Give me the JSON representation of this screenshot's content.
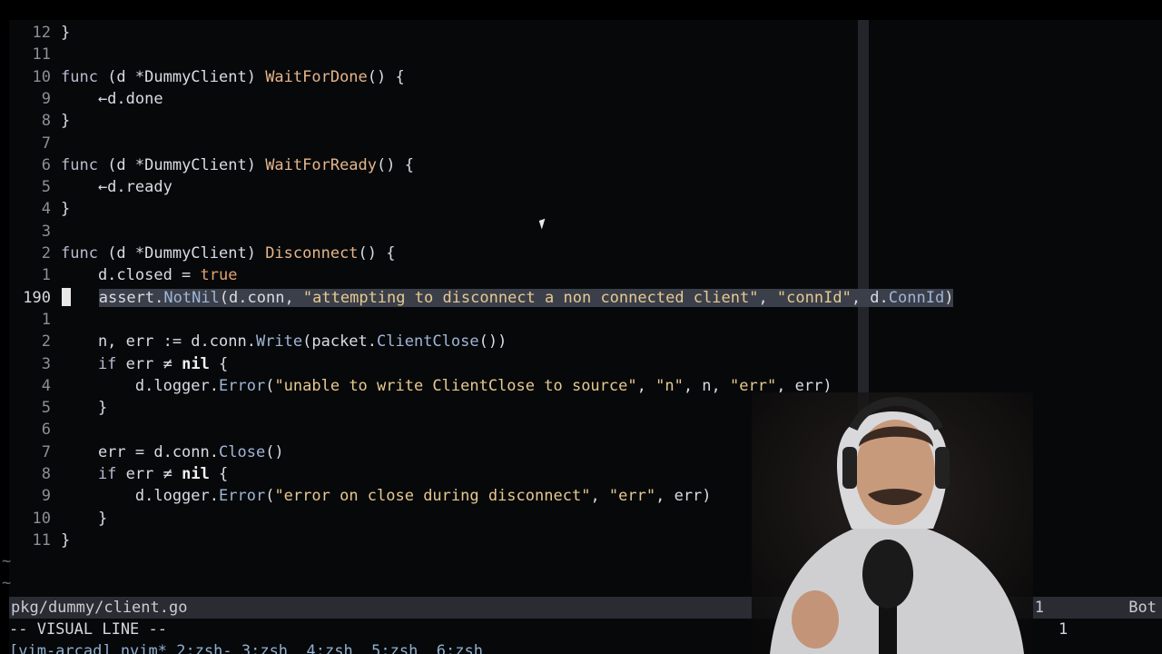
{
  "editor": {
    "lines": [
      {
        "num": "12",
        "parts": [
          [
            "typ",
            "}"
          ]
        ]
      },
      {
        "num": "11",
        "parts": []
      },
      {
        "num": "10",
        "parts": [
          [
            "kw",
            "func "
          ],
          [
            "typ",
            "(d *DummyClient) "
          ],
          [
            "fn",
            "WaitForDone"
          ],
          [
            "typ",
            "() {"
          ]
        ]
      },
      {
        "num": "9",
        "parts": [
          [
            "typ",
            "    ←d.done"
          ]
        ]
      },
      {
        "num": "8",
        "parts": [
          [
            "typ",
            "}"
          ]
        ]
      },
      {
        "num": "7",
        "parts": []
      },
      {
        "num": "6",
        "parts": [
          [
            "kw",
            "func "
          ],
          [
            "typ",
            "(d *DummyClient) "
          ],
          [
            "fn",
            "WaitForReady"
          ],
          [
            "typ",
            "() {"
          ]
        ]
      },
      {
        "num": "5",
        "parts": [
          [
            "typ",
            "    ←d.ready"
          ]
        ]
      },
      {
        "num": "4",
        "parts": [
          [
            "typ",
            "}"
          ]
        ]
      },
      {
        "num": "3",
        "parts": []
      },
      {
        "num": "2",
        "parts": [
          [
            "kw",
            "func "
          ],
          [
            "typ",
            "(d *DummyClient) "
          ],
          [
            "fn",
            "Disconnect"
          ],
          [
            "typ",
            "() {"
          ]
        ]
      },
      {
        "num": "1",
        "parts": [
          [
            "typ",
            "    d.closed = "
          ],
          [
            "bool",
            "true"
          ]
        ]
      },
      {
        "num": "190",
        "current": true,
        "parts": [
          [
            "typ",
            "assert."
          ],
          [
            "method",
            "NotNil"
          ],
          [
            "typ",
            "(d.conn, "
          ],
          [
            "str",
            "\"attempting to disconnect a non connected client\""
          ],
          [
            "typ",
            ", "
          ],
          [
            "str",
            "\"connId\""
          ],
          [
            "typ",
            ", d."
          ],
          [
            "method",
            "ConnId"
          ],
          [
            "typ",
            ")"
          ]
        ]
      },
      {
        "num": "1",
        "parts": []
      },
      {
        "num": "2",
        "parts": [
          [
            "typ",
            "    n, err := d.conn."
          ],
          [
            "method",
            "Write"
          ],
          [
            "typ",
            "(packet."
          ],
          [
            "method",
            "ClientClose"
          ],
          [
            "typ",
            "())"
          ]
        ]
      },
      {
        "num": "3",
        "parts": [
          [
            "kw",
            "    if "
          ],
          [
            "typ",
            "err "
          ],
          [
            "typ",
            "≠ "
          ],
          [
            "nil",
            "nil"
          ],
          [
            "typ",
            " {"
          ]
        ]
      },
      {
        "num": "4",
        "parts": [
          [
            "typ",
            "        d.logger."
          ],
          [
            "method",
            "Error"
          ],
          [
            "typ",
            "("
          ],
          [
            "str",
            "\"unable to write ClientClose to source\""
          ],
          [
            "typ",
            ", "
          ],
          [
            "str",
            "\"n\""
          ],
          [
            "typ",
            ", n, "
          ],
          [
            "str",
            "\"err\""
          ],
          [
            "typ",
            ", err)"
          ]
        ]
      },
      {
        "num": "5",
        "parts": [
          [
            "typ",
            "    }"
          ]
        ]
      },
      {
        "num": "6",
        "parts": []
      },
      {
        "num": "7",
        "parts": [
          [
            "typ",
            "    err = d.conn."
          ],
          [
            "method",
            "Close"
          ],
          [
            "typ",
            "()"
          ]
        ]
      },
      {
        "num": "8",
        "parts": [
          [
            "kw",
            "    if "
          ],
          [
            "typ",
            "err "
          ],
          [
            "typ",
            "≠ "
          ],
          [
            "nil",
            "nil"
          ],
          [
            "typ",
            " {"
          ]
        ]
      },
      {
        "num": "9",
        "parts": [
          [
            "typ",
            "        d.logger."
          ],
          [
            "method",
            "Error"
          ],
          [
            "typ",
            "("
          ],
          [
            "str",
            "\"error on close during disconnect\""
          ],
          [
            "typ",
            ", "
          ],
          [
            "str",
            "\"err\""
          ],
          [
            "typ",
            ", err)"
          ]
        ]
      },
      {
        "num": "10",
        "parts": [
          [
            "typ",
            "    }"
          ]
        ]
      },
      {
        "num": "11",
        "parts": [
          [
            "typ",
            "}"
          ]
        ]
      }
    ],
    "tilde": "~"
  },
  "status": {
    "file": "pkg/dummy/client.go",
    "position": "1",
    "scroll": "Bot"
  },
  "mode": {
    "text": "-- VISUAL LINE --",
    "count": "1"
  },
  "tmux": {
    "text": "[vim-arcad] nvim* 2:zsh- 3:zsh  4:zsh  5:zsh  6:zsh"
  },
  "colors": {
    "background": "#07080a",
    "selection": "#3b3f4a",
    "string": "#e6c98f",
    "function": "#e4b58a"
  }
}
